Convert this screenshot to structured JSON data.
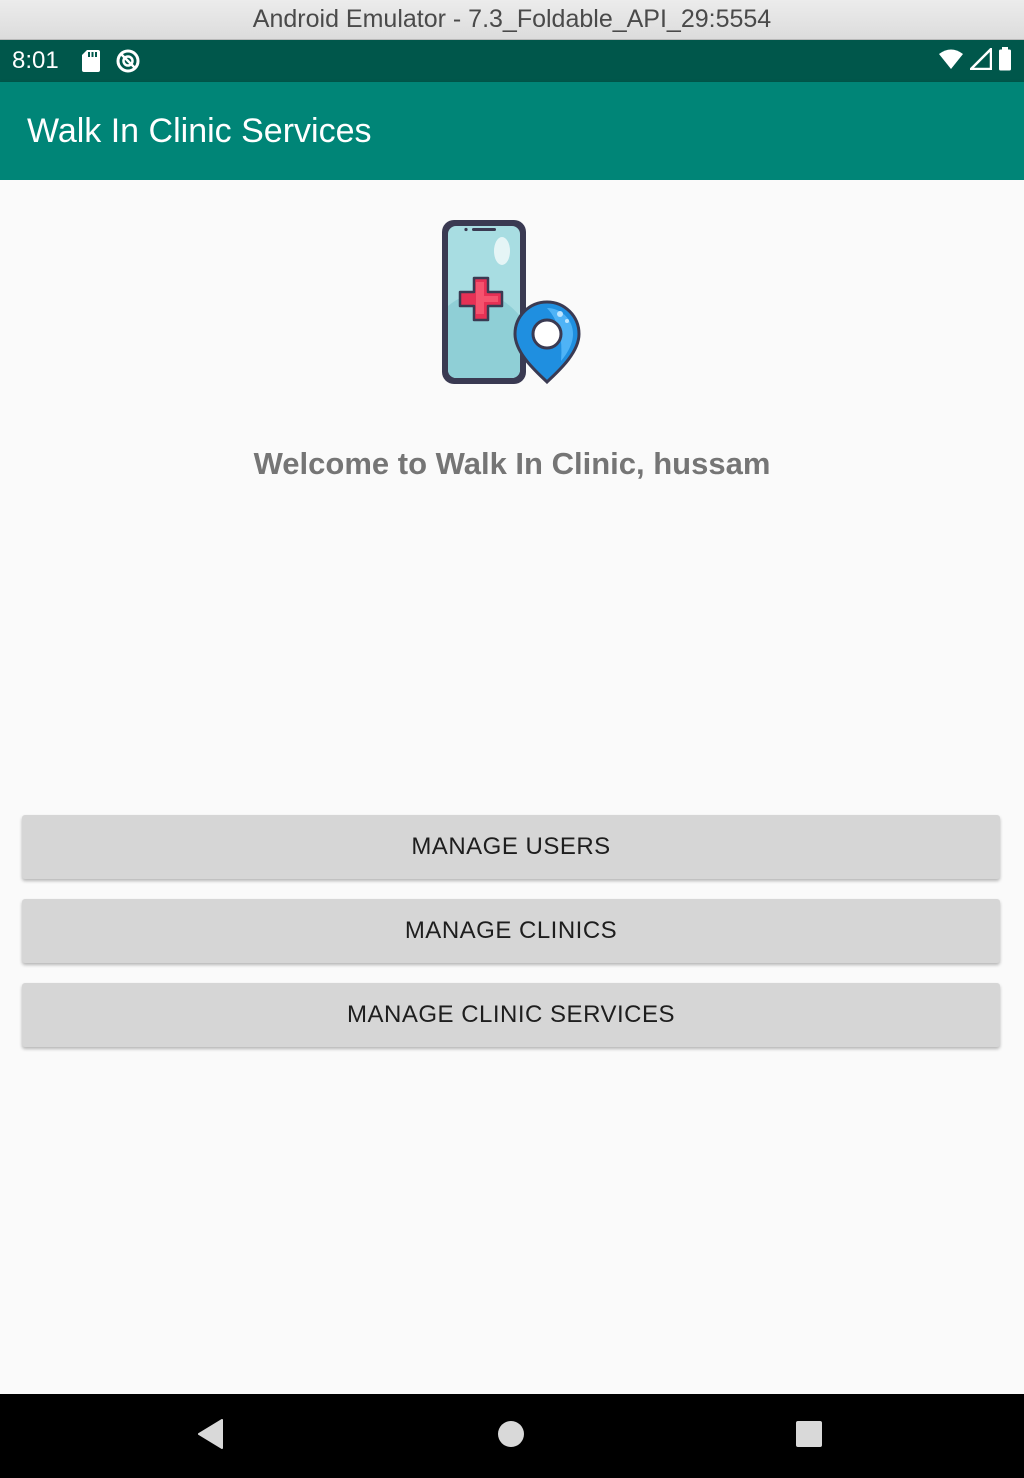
{
  "window": {
    "title": "Android Emulator - 7.3_Foldable_API_29:5554"
  },
  "status_bar": {
    "time": "8:01",
    "icons_left": [
      "sd-card-icon",
      "data-saver-icon"
    ],
    "icons_right": [
      "wifi-icon",
      "cell-signal-icon",
      "battery-icon"
    ],
    "color": "#00574b"
  },
  "app_bar": {
    "title": "Walk In Clinic Services",
    "color": "#008577"
  },
  "main": {
    "logo_icon": "clinic-phone-location-icon",
    "welcome_text": "Welcome to Walk In Clinic, hussam",
    "buttons": [
      {
        "label": "MANAGE USERS"
      },
      {
        "label": "MANAGE CLINICS"
      },
      {
        "label": "MANAGE CLINIC SERVICES"
      }
    ]
  },
  "nav_bar": {
    "items": [
      "back-icon",
      "home-icon",
      "recents-icon"
    ]
  }
}
